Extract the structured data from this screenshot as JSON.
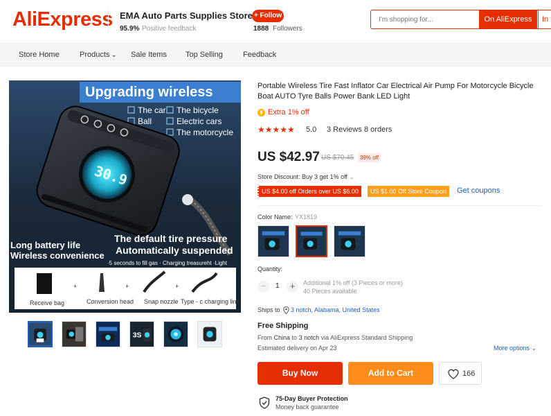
{
  "header": {
    "logo": "AliExpress",
    "store_name": "EMA Auto Parts Supplies Store",
    "feedback_pct": "95.9%",
    "feedback_label": "Positive feedback",
    "follow_label": "+ Follow",
    "followers_count": "1888",
    "followers_label": "Followers",
    "search_placeholder": "I'm shopping for...",
    "search_on_ali": "On AliExpress",
    "search_in_store": "In this store"
  },
  "nav": {
    "items": [
      "Store Home",
      "Products",
      "Sale Items",
      "Top Selling",
      "Feedback"
    ]
  },
  "gallery": {
    "banner_text": "Upgrading wireless",
    "checks": [
      "The car",
      "The bicycle",
      "Ball",
      "Electric cars",
      "The motorcycle"
    ],
    "caption_right_1": "The default tire pressure",
    "caption_right_2": "Automatically suspended",
    "caption_left_1": "Long battery life",
    "caption_left_2": "Wireless convenience",
    "sub_caption": "·5 seconds to fill gas · Charging treasureht ·Light",
    "accessories": [
      "Receive bag",
      "Conversion head",
      "Snap nozzle",
      "Type - c charging line"
    ],
    "device_label": "30.9"
  },
  "product": {
    "title": "Portable Wireless Tire Fast Inflator Car Electrical Air Pump For Motorcycle Bicycle Boat AUTO Tyre Balls Power Bank LED Light",
    "extra_icon": "¥",
    "extra_text": "Extra 1% off",
    "stars": "★★★★★",
    "rating": "5.0",
    "reviews": "3 Reviews",
    "orders": "8 orders",
    "price": "US $42.97",
    "old_price": "US $70.45",
    "discount": "39% off",
    "store_discount": "Store Discount: Buy 3 get 1% off",
    "coupon_1": "US $4.00 off Orders over US $6.00",
    "coupon_2": "US $1.00 Off Store Coupon",
    "get_coupons": "Get coupons",
    "color_label": "Color Name:",
    "color_value": "YX1819",
    "quantity_label": "Quantity:",
    "quantity": "1",
    "qty_additional": "Additional 1% off (3 Pieces or more)",
    "qty_available": "40 Pieces available",
    "ships_to_label": "Ships to",
    "ships_to_location": "3 notch, Alabama, United States",
    "free_shipping": "Free Shipping",
    "ship_from": "From",
    "ship_from_country": "China",
    "ship_to_word": "to",
    "ship_to_place": "3 notch",
    "ship_via": "via AliExpress Standard Shipping",
    "delivery": "Estimated delivery on Apr 23",
    "more_options": "More options",
    "buy_now": "Buy Now",
    "add_to_cart": "Add to Cart",
    "wishlist_count": "166",
    "protection_title": "75-Day Buyer Protection",
    "protection_sub": "Money back guarantee"
  },
  "colors": {
    "brand": "#e62e04",
    "orange": "#ff8c1a",
    "link": "#1a5fc4"
  }
}
